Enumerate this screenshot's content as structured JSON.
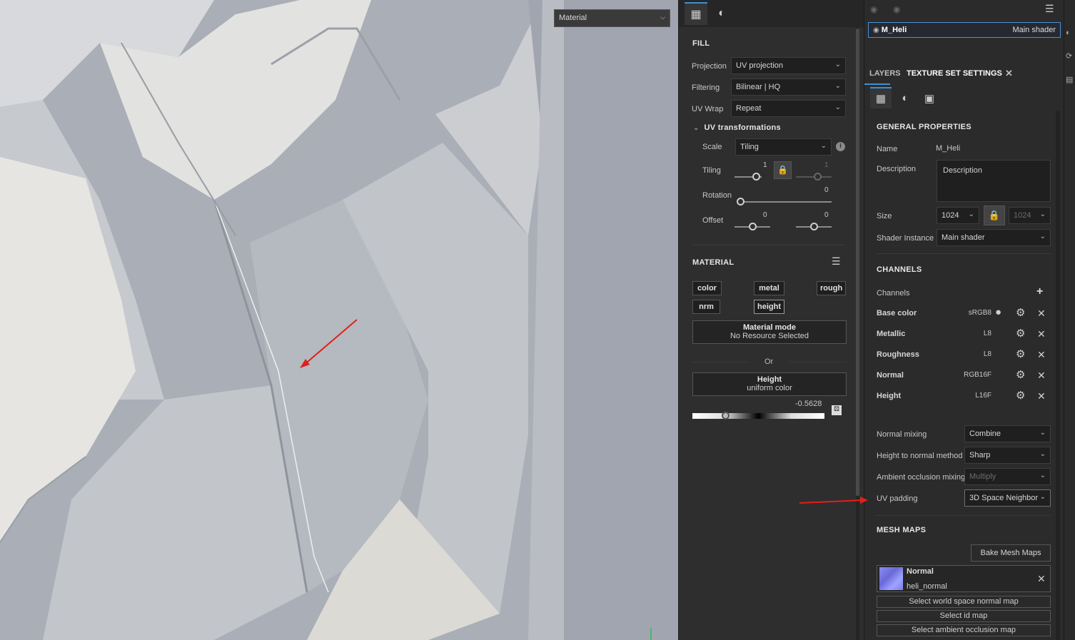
{
  "viewport": {
    "mode_select": "Material"
  },
  "fill_panel": {
    "tab_icons": [
      "layer-view-icon",
      "material-sphere-icon"
    ],
    "fill_title": "FILL",
    "projection_label": "Projection",
    "projection_value": "UV projection",
    "filtering_label": "Filtering",
    "filtering_value": "Bilinear | HQ",
    "uvwrap_label": "UV Wrap",
    "uvwrap_value": "Repeat",
    "uv_transform_title": "UV transformations",
    "scale_label": "Scale",
    "scale_value": "Tiling",
    "tiling_label": "Tiling",
    "tiling_value_a": "1",
    "tiling_value_b": "1",
    "rotation_label": "Rotation",
    "rotation_value": "0",
    "offset_label": "Offset",
    "offset_value_a": "0",
    "offset_value_b": "0",
    "material_title": "MATERIAL",
    "chips": [
      "color",
      "metal",
      "rough",
      "nrm",
      "height"
    ],
    "material_mode_title": "Material mode",
    "material_mode_sub": "No Resource Selected",
    "or_label": "Or",
    "height_title": "Height",
    "height_sub": "uniform color",
    "height_value": "-0.5628",
    "height_slider_level": 0.25
  },
  "texture_set": {
    "name": "M_Heli",
    "shader": "Main shader",
    "tab_layers": "LAYERS",
    "tab_settings": "TEXTURE SET SETTINGS",
    "general_title": "GENERAL PROPERTIES",
    "name_label": "Name",
    "name_value": "M_Heli",
    "description_label": "Description",
    "description_value": "Description",
    "size_label": "Size",
    "size_value": "1024",
    "size_value_locked": "1024",
    "shader_instance_label": "Shader Instance",
    "shader_instance_value": "Main shader",
    "channels_title": "CHANNELS",
    "channels_label": "Channels",
    "channels": [
      {
        "name": "Base color",
        "format": "sRGB8"
      },
      {
        "name": "Metallic",
        "format": "L8"
      },
      {
        "name": "Roughness",
        "format": "L8"
      },
      {
        "name": "Normal",
        "format": "RGB16F"
      },
      {
        "name": "Height",
        "format": "L16F"
      }
    ],
    "normal_mixing_label": "Normal mixing",
    "normal_mixing_value": "Combine",
    "h2n_label": "Height to normal method",
    "h2n_value": "Sharp",
    "ao_mixing_label": "Ambient occlusion mixing",
    "ao_mixing_value": "Multiply",
    "uv_padding_label": "UV padding",
    "uv_padding_value": "3D Space Neighbor",
    "mesh_maps_title": "MESH MAPS",
    "bake_button": "Bake Mesh Maps",
    "mesh_map_name": "Normal",
    "mesh_map_file": "heli_normal",
    "select_buttons": [
      "Select world space normal map",
      "Select id map",
      "Select ambient occlusion map"
    ]
  },
  "colors": {
    "accent": "#3d8fd6",
    "annotation_arrow": "#e0201b",
    "viewport_surface": "#a8adb6"
  }
}
